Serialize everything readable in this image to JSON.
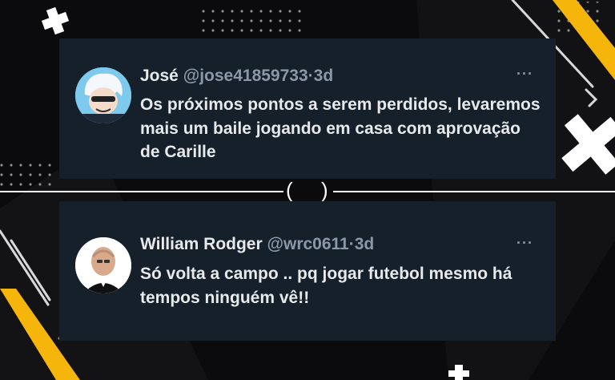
{
  "tweets": [
    {
      "name": "José",
      "handle": "@jose41859733",
      "separator": "·",
      "time": "3d",
      "text": "Os próximos pontos a serem perdidos, levaremos mais um baile jogando em casa com aprovação de Carille",
      "more": "···"
    },
    {
      "name": "William Rodger",
      "handle": "@wrc0611",
      "separator": "·",
      "time": "3d",
      "text": "Só volta a campo .. pq jogar futebol mesmo há tempos ninguém vê!!",
      "more": "···"
    }
  ],
  "divider": {
    "left_paren": "(",
    "right_paren": ")"
  },
  "colors": {
    "card": "#15202b",
    "accent": "#f5b50a",
    "muted": "#8b98a5"
  }
}
